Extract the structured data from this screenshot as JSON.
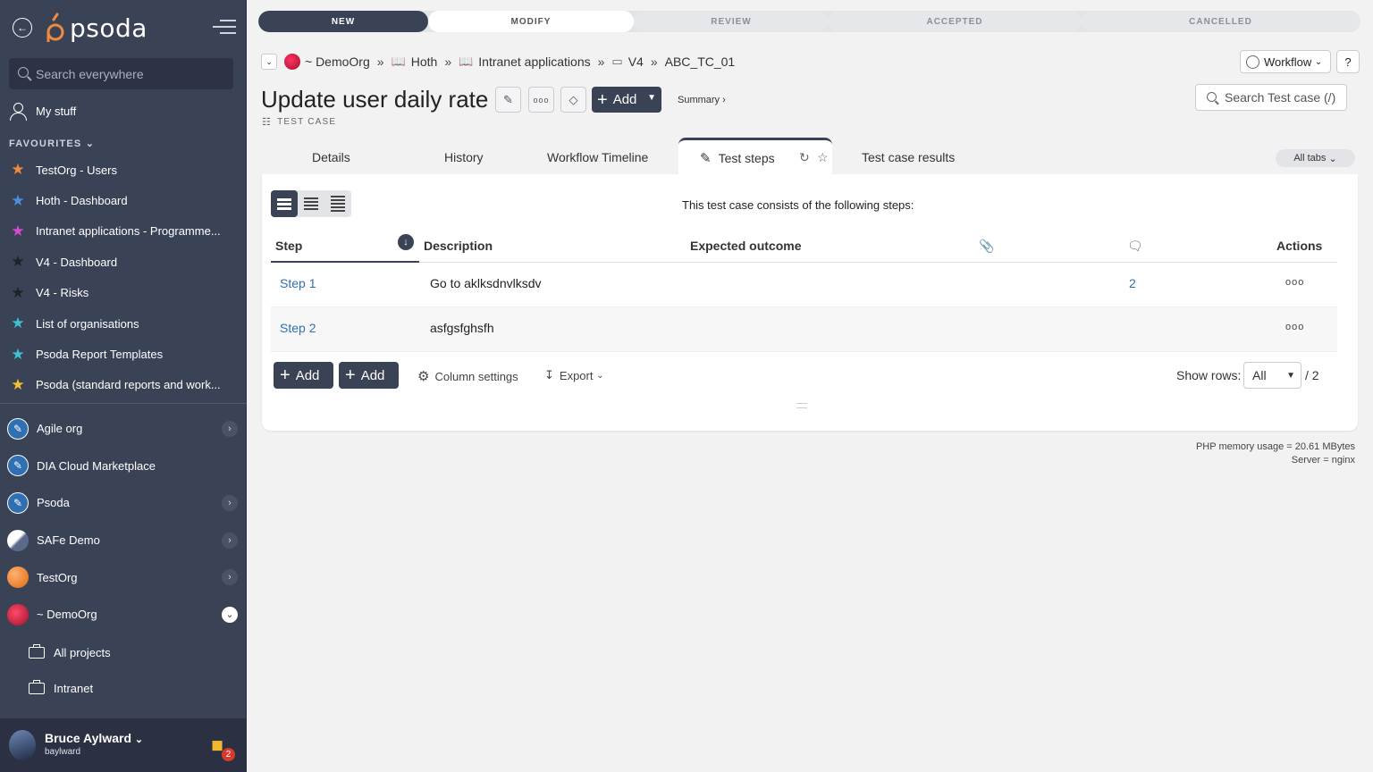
{
  "sidebar": {
    "logo_text": "psoda",
    "search_placeholder": "Search everywhere",
    "my_stuff": "My stuff",
    "favourites_heading": "FAVOURITES",
    "favourites": [
      {
        "label": "TestOrg - Users",
        "color": "#f08a3c"
      },
      {
        "label": "Hoth - Dashboard",
        "color": "#4a90e2"
      },
      {
        "label": "Intranet applications - Programme...",
        "color": "#d44bd4"
      },
      {
        "label": "V4 - Dashboard",
        "color": "#2a2e38"
      },
      {
        "label": "V4 - Risks",
        "color": "#2a2e38"
      },
      {
        "label": "List of organisations",
        "color": "#3ec1d3"
      },
      {
        "label": "Psoda Report Templates",
        "color": "#3ec1d3"
      },
      {
        "label": "Psoda (standard reports and work...",
        "color": "#f2c230"
      }
    ],
    "orgs": [
      {
        "label": "Agile org",
        "has_chevron": true
      },
      {
        "label": "DIA Cloud Marketplace",
        "has_chevron": false
      },
      {
        "label": "Psoda",
        "has_chevron": true
      },
      {
        "label": "SAFe Demo",
        "has_chevron": true
      },
      {
        "label": "TestOrg",
        "has_chevron": true
      },
      {
        "label": "~ DemoOrg",
        "has_chevron": true
      }
    ],
    "sub_items": [
      {
        "label": "All projects"
      },
      {
        "label": "Intranet"
      }
    ],
    "user": {
      "name": "Bruce Aylward",
      "login": "baylward",
      "notifications": "2"
    }
  },
  "workflow": {
    "steps": [
      "NEW",
      "MODIFY",
      "REVIEW",
      "ACCEPTED",
      "CANCELLED"
    ]
  },
  "breadcrumb": {
    "items": [
      "~ DemoOrg",
      "Hoth",
      "Intranet applications",
      "V4",
      "ABC_TC_01"
    ]
  },
  "header": {
    "title": "Update user daily rate",
    "type_label": "TEST CASE",
    "add_label": "Add",
    "summary_label": "Summary ›",
    "workflow_label": "Workflow",
    "help_label": "?",
    "search_placeholder": "Search Test case (/)"
  },
  "tabs": {
    "items": [
      "Details",
      "History",
      "Workflow Timeline",
      "Test steps",
      "Test case results"
    ],
    "all_tabs": "All tabs"
  },
  "steps_panel": {
    "intro": "This test case consists of the following steps:",
    "columns": {
      "step": "Step",
      "description": "Description",
      "expected": "Expected outcome",
      "actions": "Actions"
    },
    "rows": [
      {
        "step": "Step 1",
        "description": "Go to aklksdnvlksdv",
        "comments": "2"
      },
      {
        "step": "Step 2",
        "description": "asfgsfghsfh",
        "comments": ""
      }
    ],
    "footer": {
      "add_label_1": "Add",
      "add_label_2": "Add",
      "column_settings": "Column settings",
      "export": "Export",
      "show_rows_label": "Show rows:",
      "show_rows_value": "All",
      "total": "/ 2"
    }
  },
  "server": {
    "memory": "PHP memory usage = 20.61 MBytes",
    "server": "Server = nginx"
  }
}
